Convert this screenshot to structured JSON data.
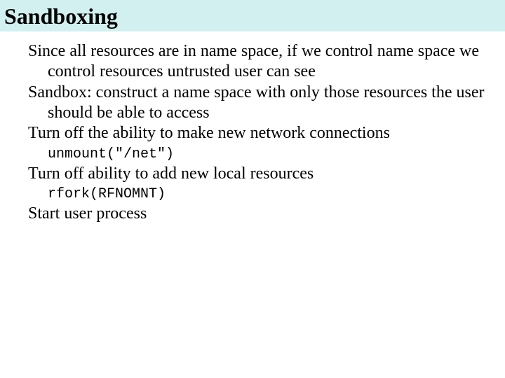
{
  "title": "Sandboxing",
  "body": {
    "p1": "Since all resources are in name space, if we control name space we control resources untrusted user can see",
    "p2": "Sandbox: construct a name space with only those resources the user should be able to access",
    "p3": "Turn off the ability to make new network connections",
    "code1": "unmount(\"/net\")",
    "p4": "Turn off ability to add new local resources",
    "code2": "rfork(RFNOMNT)",
    "p5": "Start user process"
  }
}
